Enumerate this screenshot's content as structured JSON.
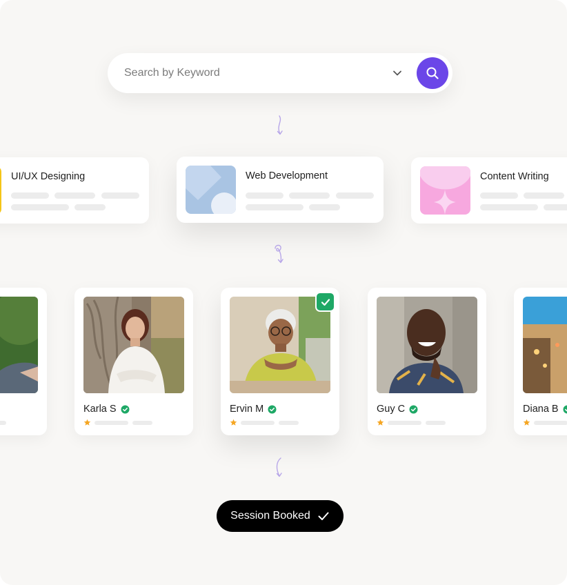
{
  "search": {
    "placeholder": "Search by Keyword",
    "value": "",
    "icon": "search-icon",
    "dropdown_icon": "chevron-down-icon",
    "accent_color": "#6b46e8"
  },
  "categories": [
    {
      "label": "UI/UX Designing",
      "thumb_color": "#f5c518"
    },
    {
      "label": "Web Development",
      "thumb_color": "#a9c4e3",
      "selected": true
    },
    {
      "label": "Content Writing",
      "thumb_color": "#f7a8df"
    }
  ],
  "mentors": [
    {
      "name": "",
      "rating_icon": "star-icon"
    },
    {
      "name": "Karla S",
      "verified": true,
      "rating_icon": "star-icon"
    },
    {
      "name": "Ervin M",
      "verified": true,
      "selected": true,
      "rating_icon": "star-icon"
    },
    {
      "name": "Guy C",
      "verified": true,
      "rating_icon": "star-icon"
    },
    {
      "name": "Diana B",
      "verified": true,
      "rating_icon": "star-icon"
    }
  ],
  "colors": {
    "verified": "#1ea866",
    "star": "#f5a623",
    "connector": "#b7a6e8"
  },
  "session": {
    "label": "Session Booked",
    "icon": "checkmark-icon"
  }
}
